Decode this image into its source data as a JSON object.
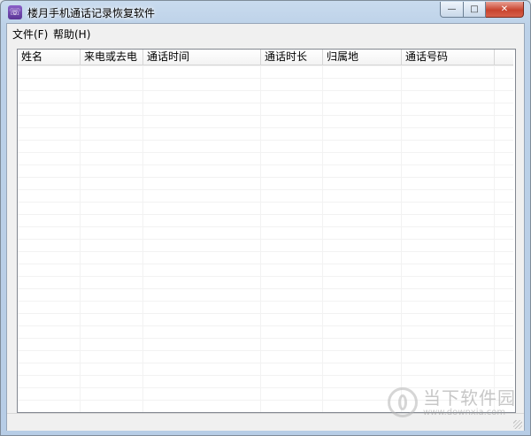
{
  "window": {
    "title": "楼月手机通话记录恢复软件",
    "app_icon_glyph": "☏",
    "buttons": {
      "minimize": "—",
      "maximize": "□",
      "close": "✕"
    }
  },
  "menubar": {
    "items": [
      {
        "label": "文件(F)"
      },
      {
        "label": "帮助(H)"
      }
    ]
  },
  "call_list": {
    "columns": [
      {
        "label": "姓名"
      },
      {
        "label": "来电或去电"
      },
      {
        "label": "通话时间"
      },
      {
        "label": "通话时长"
      },
      {
        "label": "归属地"
      },
      {
        "label": "通话号码"
      }
    ],
    "rows": []
  },
  "watermark": {
    "name": "当下软件园",
    "url": "www.downxia.com"
  },
  "colors": {
    "title_gradient_top": "#c9dbee",
    "close_button": "#c8432e",
    "app_icon": "#6a42a8"
  }
}
